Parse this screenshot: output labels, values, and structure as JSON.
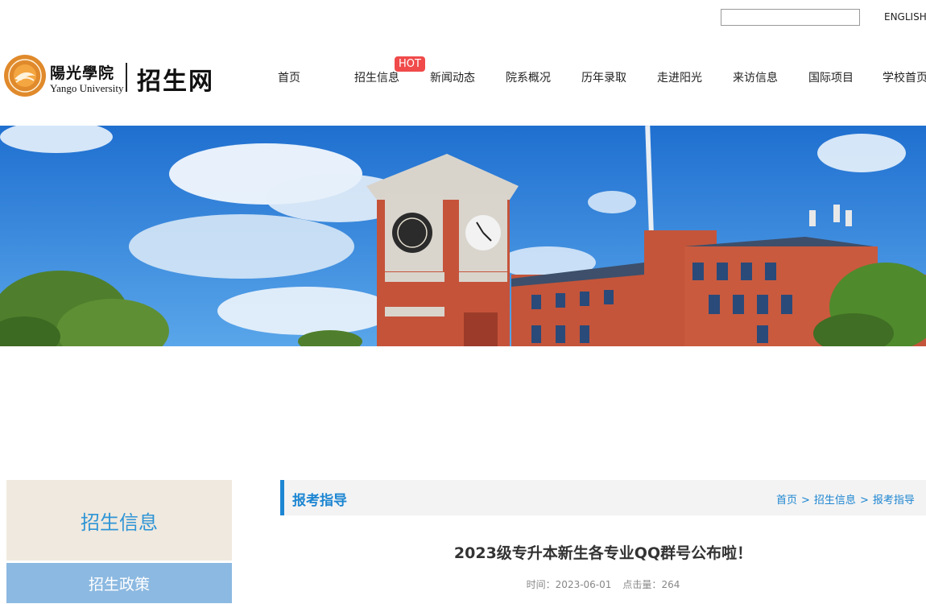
{
  "header": {
    "search": {
      "value": "",
      "placeholder": ""
    },
    "language_link": "ENGLISH",
    "logo": {
      "name_cn": "陽光學院",
      "name_en": "Yango University",
      "site_name": "招生网"
    }
  },
  "nav": {
    "items": [
      {
        "label": "首页"
      },
      {
        "label": "招生信息"
      },
      {
        "label": "新闻动态"
      },
      {
        "label": "院系概况"
      },
      {
        "label": "历年录取"
      },
      {
        "label": "走进阳光"
      },
      {
        "label": "来访信息"
      },
      {
        "label": "国际项目"
      },
      {
        "label": "学校首页"
      }
    ],
    "hot_badge": "HOT"
  },
  "sidebar": {
    "title": "招生信息",
    "items": [
      {
        "label": "招生政策"
      }
    ]
  },
  "content": {
    "section_title": "报考指导",
    "breadcrumb": [
      "首页",
      "招生信息",
      "报考指导"
    ],
    "breadcrumb_sep": ">",
    "article": {
      "title": "2023级专升本新生各专业QQ群号公布啦！",
      "time_label": "时间：",
      "time": "2023-06-01",
      "views_label": "点击量：",
      "views": "264"
    }
  },
  "colors": {
    "accent": "#1d86d2",
    "hot": "#f04a4a",
    "sidebar_active": "#8cb9e1",
    "sidebar_header_bg": "#f0e9df"
  }
}
